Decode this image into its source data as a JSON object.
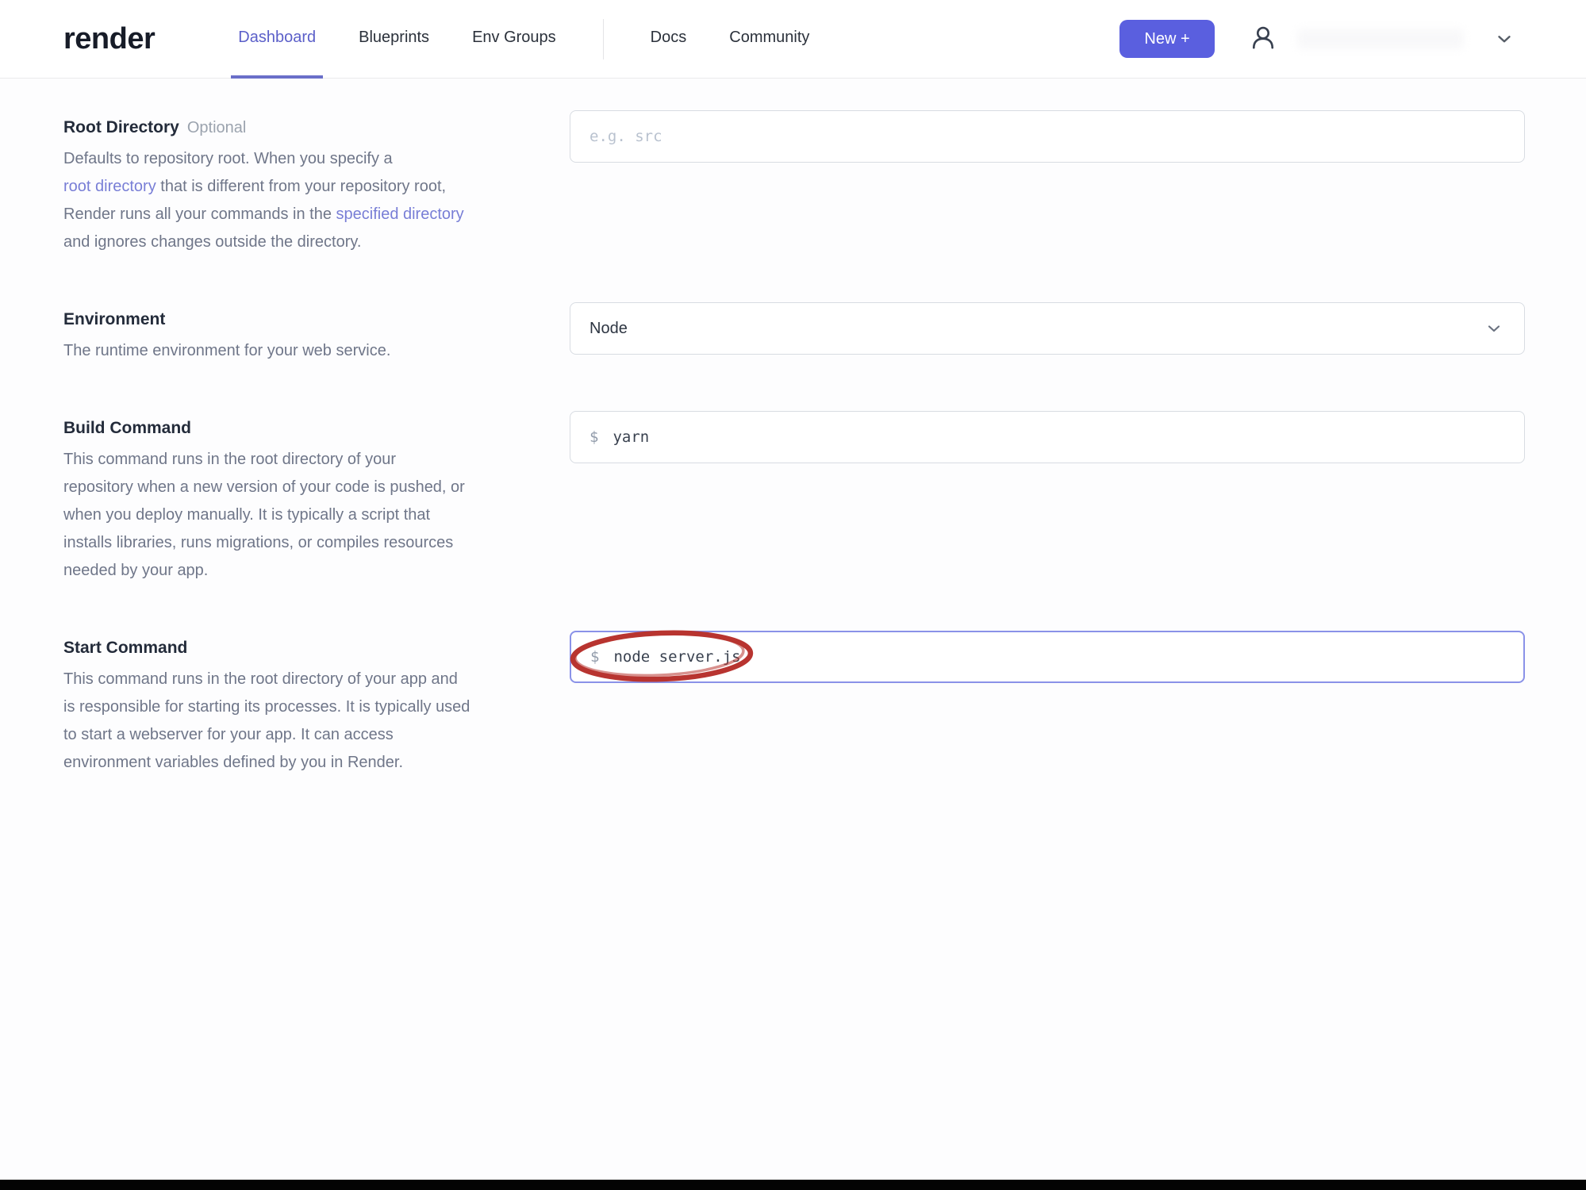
{
  "colors": {
    "accent_button": "#5a5fdf",
    "accent_active_nav": "#5b5fc9",
    "link_purple": "#787ed6",
    "focused_input_border": "#8a92e8",
    "annotation_red": "#b83430"
  },
  "header": {
    "logo_text": "render",
    "nav": {
      "dashboard": "Dashboard",
      "blueprints": "Blueprints",
      "env_groups": "Env Groups",
      "docs": "Docs",
      "community": "Community"
    },
    "new_button_label": "New +",
    "icons": {
      "account": "person-outline-icon",
      "account_menu": "chevron-down-icon"
    }
  },
  "sections": {
    "root_directory": {
      "label": "Root Directory",
      "optional_tag": "Optional",
      "desc_line1": "Defaults to repository root. When you specify a",
      "desc_line2_link": "root directory",
      "desc_line2_rest": " that is different from your repository root,",
      "desc_line3_pre": "Render runs all your commands in the ",
      "desc_line3_link": "specified directory",
      "desc_line4": "and ignores changes outside the directory.",
      "input_placeholder": "e.g. src"
    },
    "environment": {
      "label": "Environment",
      "description": "The runtime environment for your web service.",
      "select_value": "Node"
    },
    "build_command": {
      "label": "Build Command",
      "desc_lines": [
        "This command runs in the root directory of your",
        "repository when a new version of your code is pushed, or",
        "when you deploy manually. It is typically a script that",
        "installs libraries, runs migrations, or compiles resources",
        "needed by your app."
      ],
      "prompt_prefix": "$",
      "input_value": "yarn"
    },
    "start_command": {
      "label": "Start Command",
      "desc_lines": [
        "This command runs in the root directory of your app and",
        "is responsible for starting its processes. It is typically used",
        "to start a webserver for your app. It can access",
        "environment variables defined by you in Render."
      ],
      "prompt_prefix": "$",
      "input_value": "node server.js",
      "annotation": "hand-drawn red ellipse circling the start command"
    }
  }
}
